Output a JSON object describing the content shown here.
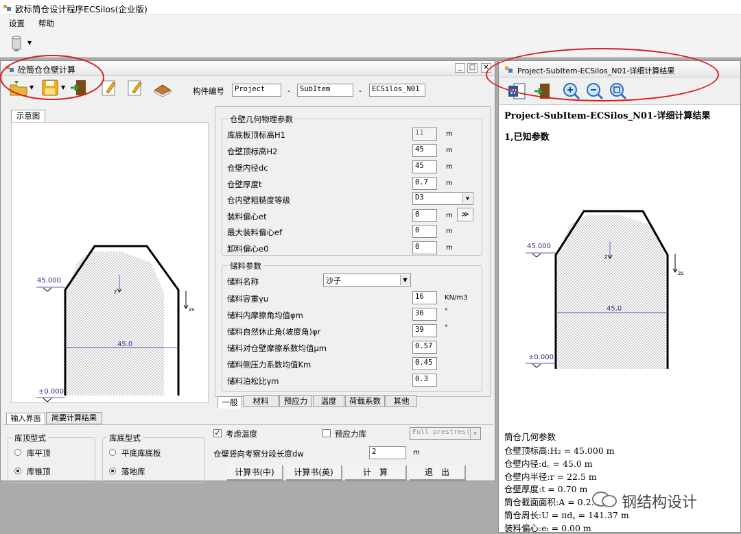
{
  "app": {
    "title": "欧标筒仓设计程序ECSilos(企业版)"
  },
  "menu": {
    "settings": "设置",
    "help": "帮助"
  },
  "left_window": {
    "title": "砼筒仓仓壁计算",
    "component_code_label": "构件编号",
    "project": "Project",
    "subitem": "SubItem",
    "item": "ECSilos_N01",
    "dash": "-",
    "diagram_tab": "示意图",
    "diagram": {
      "top_level": "45.000",
      "mid_label": "45.0",
      "base_level": "±0.000",
      "zs": "zs",
      "z": "z"
    },
    "geom": {
      "title": "仓壁几何物理参数",
      "fields": [
        {
          "label": "库底板顶标高H1",
          "value": "11",
          "unit": "m"
        },
        {
          "label": "仓壁顶标高H2",
          "value": "45",
          "unit": "m"
        },
        {
          "label": "仓壁内径dc",
          "value": "45",
          "unit": "m"
        },
        {
          "label": "仓壁厚度t",
          "value": "0.7",
          "unit": "m"
        },
        {
          "label": "仓内壁粗糙度等级",
          "value": "D3",
          "unit": ""
        },
        {
          "label": "装料偏心et",
          "value": "0",
          "unit": "m"
        },
        {
          "label": "最大装料偏心ef",
          "value": "0",
          "unit": "m"
        },
        {
          "label": "卸料偏心e0",
          "value": "0",
          "unit": "m"
        }
      ],
      "more_btn": "≫"
    },
    "storage": {
      "title": "储料参数",
      "fields": [
        {
          "label": "储料名称",
          "value": "沙子",
          "unit": ""
        },
        {
          "label": "储料容重γu",
          "value": "16",
          "unit": "KN/m3"
        },
        {
          "label": "储料内摩擦角均值φm",
          "value": "36",
          "unit": "°"
        },
        {
          "label": "储料自然休止角(坡度角)φr",
          "value": "39",
          "unit": "°"
        },
        {
          "label": "储料对仓壁摩擦系数均值μm",
          "value": "0.57",
          "unit": ""
        },
        {
          "label": "储料侧压力系数均值Km",
          "value": "0.45",
          "unit": ""
        },
        {
          "label": "储料泊松比γm",
          "value": "0.3",
          "unit": ""
        }
      ]
    },
    "param_tabs": [
      "一般",
      "材料",
      "预应力",
      "温度",
      "荷载系数",
      "其他"
    ],
    "bottom_tabs": [
      "输入界面",
      "简要计算结果"
    ],
    "roof": {
      "title": "库顶型式",
      "opt1": "库平顶",
      "opt2": "库锥顶"
    },
    "bottom": {
      "title": "库底型式",
      "opt1": "平底库底板",
      "opt2": "落地库"
    },
    "consider_temp": "考虑温度",
    "prestress": "预应力库",
    "prestress_select": "Full prestres(",
    "seg_label": "仓壁竖向考察分段长度dw",
    "seg_value": "2",
    "seg_unit": "m",
    "buttons": {
      "calc_cn": "计算书(中)",
      "calc_en": "计算书(英)",
      "calc": "计　算",
      "exit": "退　出"
    }
  },
  "right_window": {
    "title": "Project-SubItem-ECSilos_N01-详细计算结果",
    "heading": "Project-SubItem-ECSilos_N01-详细计算结果",
    "section1": "1,已知参数",
    "diagram": {
      "top_level": "45.000",
      "mid_label": "45.0",
      "base_level": "±0.000",
      "zs": "zs",
      "z": "z"
    },
    "lines": [
      "筒仓几何参数",
      "仓壁顶标高:H₂ = 45.000 m",
      "仓壁内径:d꜀ = 45.0 m",
      "仓壁内半径:r = 22.5 m",
      "仓壁厚度:t = 0.70 m",
      "筒仓截面面积:A = 0.2…",
      "筒仓周长:U = πd꜀ = 141.37 m",
      "装料偏心:eₜ = 0.00 m"
    ]
  },
  "watermark": "钢结构设计",
  "colors": {
    "highlight": "#d61e1e",
    "hatch": "#b8b8b8",
    "line": "#5a5ab8"
  }
}
